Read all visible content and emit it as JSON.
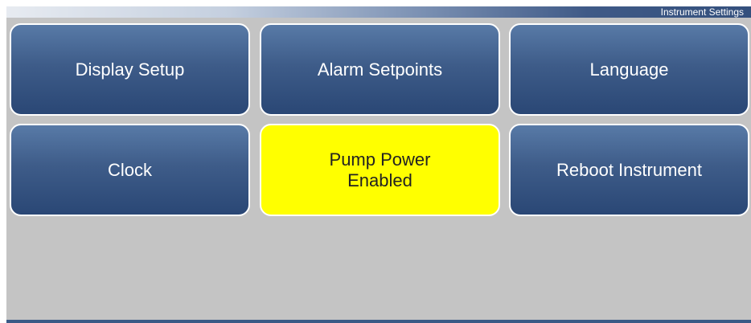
{
  "header": {
    "title": "Instrument Settings"
  },
  "tiles": [
    {
      "label": "Display Setup"
    },
    {
      "label": "Alarm Setpoints"
    },
    {
      "label": "Language"
    },
    {
      "label": "Clock"
    },
    {
      "label": "Pump Power",
      "sublabel": "Enabled",
      "state": "on"
    },
    {
      "label": "Reboot Instrument"
    }
  ],
  "colors": {
    "tile_blue": "#3e5c89",
    "tile_active": "#ffff00",
    "background": "#c4c4c4"
  }
}
